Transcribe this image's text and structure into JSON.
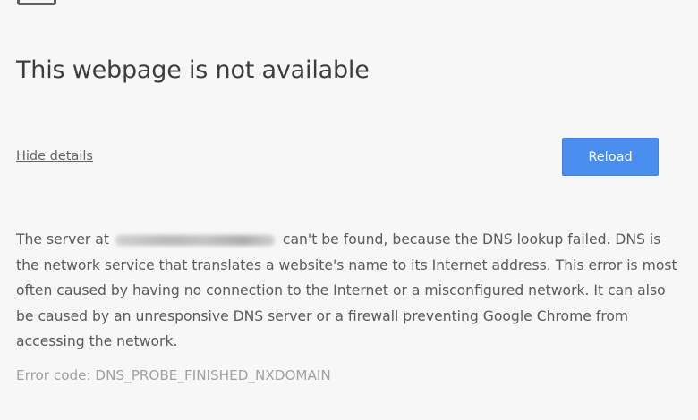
{
  "error_page": {
    "title": "This webpage is not available",
    "details_toggle_label": "Hide details",
    "reload_label": "Reload",
    "explanation_before_host": "The server at",
    "explanation_after_host": "can't be found, because the DNS lookup failed. DNS is the network service that translates a website's name to its Internet address. This error is most often caused by having no connection to the Internet or a misconfigured network. It can also be caused by an unresponsive DNS server or a firewall preventing Google Chrome from accessing the network.",
    "error_code": "Error code: DNS_PROBE_FINISHED_NXDOMAIN",
    "icon": "sad-page-icon",
    "colors": {
      "background": "#f7f7f7",
      "button_blue": "#4a8ef0",
      "text": "#646464",
      "error_code_text": "#a0a0a0"
    }
  }
}
